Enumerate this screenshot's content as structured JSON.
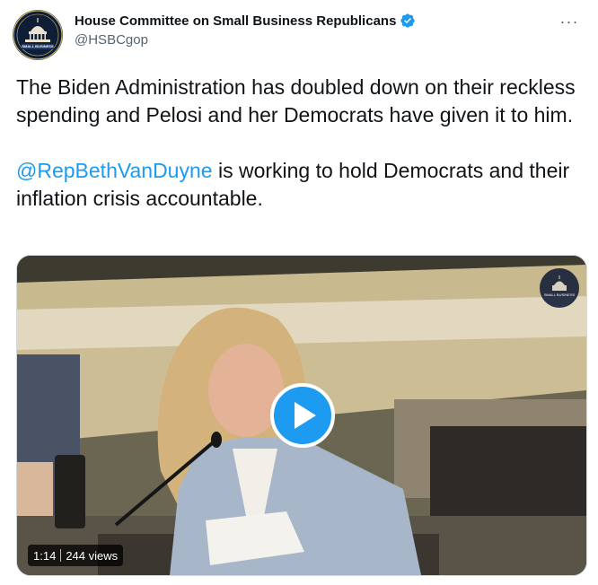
{
  "author": {
    "display_name": "House Committee on Small Business Republicans",
    "handle": "@HSBCgop",
    "verified": true,
    "avatar_icon": "capitol-dome-logo",
    "avatar_text": "SMALL BUSINESS"
  },
  "more_menu": {
    "icon": "more-horizontal-icon",
    "glyph": "···"
  },
  "tweet": {
    "paragraph1": "The Biden Administration has doubled down on their reckless spending and Pelosi and her Democrats have given it to him.",
    "mention": "@RepBethVanDuyne",
    "paragraph2_rest": " is working to hold Democrats and their inflation crisis accountable."
  },
  "video": {
    "duration": "1:14",
    "views": "244 views",
    "play_icon": "play-icon",
    "watermark_text": "SMALL BUSINESS"
  },
  "colors": {
    "accent": "#1d9bf0",
    "text_primary": "#0f1419",
    "text_secondary": "#536471",
    "border": "#cfd9de"
  }
}
